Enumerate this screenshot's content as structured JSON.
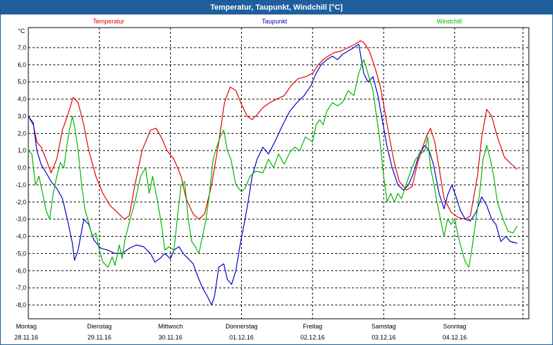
{
  "window": {
    "title": "Temperatur, Taupunkt, Windchill [°C]"
  },
  "colors": {
    "temperatur": "#e00000",
    "taupunkt": "#0000c8",
    "windchill": "#00b400",
    "grid": "#000000"
  },
  "chart_data": {
    "type": "line",
    "ylabel": "°C",
    "ylim": [
      -8.8,
      8.0
    ],
    "yticks": [
      "7,0",
      "6,0",
      "5,0",
      "4,0",
      "3,0",
      "2,0",
      "1,0",
      "0,0",
      "-1,0",
      "-2,0",
      "-3,0",
      "-4,0",
      "-5,0",
      "-6,0",
      "-7,0",
      "-8,0"
    ],
    "xlim": [
      0,
      7
    ],
    "grid": true,
    "days": [
      {
        "day": "Montag",
        "date": "28.11.16"
      },
      {
        "day": "Dienstag",
        "date": "29.11.16"
      },
      {
        "day": "Mittwoch",
        "date": "30.11.16"
      },
      {
        "day": "Donnerstag",
        "date": "01.12.16"
      },
      {
        "day": "Freitag",
        "date": "02.12.16"
      },
      {
        "day": "Samstag",
        "date": "03.12.16"
      },
      {
        "day": "Sonntag",
        "date": "04.12.16"
      }
    ],
    "series": [
      {
        "name": "Temperatur",
        "color": "#e00000",
        "points": [
          [
            0.0,
            3.0
          ],
          [
            0.07,
            2.5
          ],
          [
            0.12,
            1.5
          ],
          [
            0.18,
            1.2
          ],
          [
            0.25,
            0.5
          ],
          [
            0.32,
            -0.3
          ],
          [
            0.4,
            0.5
          ],
          [
            0.48,
            2.2
          ],
          [
            0.55,
            3.0
          ],
          [
            0.63,
            4.1
          ],
          [
            0.7,
            3.8
          ],
          [
            0.78,
            2.5
          ],
          [
            0.85,
            1.0
          ],
          [
            0.95,
            -0.5
          ],
          [
            1.05,
            -1.5
          ],
          [
            1.15,
            -2.2
          ],
          [
            1.25,
            -2.6
          ],
          [
            1.35,
            -3.0
          ],
          [
            1.42,
            -2.8
          ],
          [
            1.5,
            -1.0
          ],
          [
            1.6,
            1.0
          ],
          [
            1.72,
            2.2
          ],
          [
            1.8,
            2.3
          ],
          [
            1.88,
            1.7
          ],
          [
            1.95,
            1.0
          ],
          [
            2.05,
            0.5
          ],
          [
            2.15,
            -0.5
          ],
          [
            2.22,
            -1.8
          ],
          [
            2.32,
            -2.7
          ],
          [
            2.4,
            -3.0
          ],
          [
            2.48,
            -2.7
          ],
          [
            2.58,
            -1.0
          ],
          [
            2.68,
            1.5
          ],
          [
            2.76,
            3.8
          ],
          [
            2.84,
            4.7
          ],
          [
            2.92,
            4.5
          ],
          [
            3.0,
            3.7
          ],
          [
            3.08,
            3.0
          ],
          [
            3.15,
            2.8
          ],
          [
            3.22,
            3.1
          ],
          [
            3.3,
            3.5
          ],
          [
            3.4,
            3.8
          ],
          [
            3.5,
            4.0
          ],
          [
            3.6,
            4.2
          ],
          [
            3.7,
            4.8
          ],
          [
            3.8,
            5.2
          ],
          [
            3.9,
            5.3
          ],
          [
            4.0,
            5.5
          ],
          [
            4.08,
            6.0
          ],
          [
            4.15,
            6.3
          ],
          [
            4.22,
            6.5
          ],
          [
            4.3,
            6.7
          ],
          [
            4.4,
            6.8
          ],
          [
            4.5,
            7.0
          ],
          [
            4.6,
            7.2
          ],
          [
            4.67,
            7.4
          ],
          [
            4.72,
            7.3
          ],
          [
            4.8,
            6.8
          ],
          [
            4.88,
            5.8
          ],
          [
            4.95,
            4.8
          ],
          [
            5.02,
            3.2
          ],
          [
            5.08,
            1.8
          ],
          [
            5.15,
            0.3
          ],
          [
            5.22,
            -0.8
          ],
          [
            5.32,
            -1.3
          ],
          [
            5.4,
            -1.1
          ],
          [
            5.48,
            0.3
          ],
          [
            5.55,
            1.2
          ],
          [
            5.6,
            1.8
          ],
          [
            5.66,
            2.3
          ],
          [
            5.72,
            1.5
          ],
          [
            5.78,
            0.0
          ],
          [
            5.85,
            -1.8
          ],
          [
            5.95,
            -2.6
          ],
          [
            6.05,
            -2.9
          ],
          [
            6.15,
            -3.0
          ],
          [
            6.22,
            -2.8
          ],
          [
            6.32,
            -0.5
          ],
          [
            6.38,
            1.8
          ],
          [
            6.45,
            3.4
          ],
          [
            6.52,
            3.0
          ],
          [
            6.6,
            1.8
          ],
          [
            6.7,
            0.6
          ],
          [
            6.8,
            0.2
          ],
          [
            6.88,
            -0.1
          ]
        ]
      },
      {
        "name": "Taupunkt",
        "color": "#0000c8",
        "points": [
          [
            0.0,
            3.0
          ],
          [
            0.07,
            2.6
          ],
          [
            0.12,
            1.0
          ],
          [
            0.18,
            0.2
          ],
          [
            0.25,
            -0.3
          ],
          [
            0.32,
            -0.8
          ],
          [
            0.4,
            -1.2
          ],
          [
            0.48,
            -1.8
          ],
          [
            0.55,
            -3.0
          ],
          [
            0.62,
            -4.4
          ],
          [
            0.65,
            -5.4
          ],
          [
            0.7,
            -4.8
          ],
          [
            0.78,
            -3.0
          ],
          [
            0.85,
            -3.3
          ],
          [
            0.92,
            -4.2
          ],
          [
            1.02,
            -4.7
          ],
          [
            1.12,
            -4.8
          ],
          [
            1.22,
            -5.0
          ],
          [
            1.32,
            -5.0
          ],
          [
            1.42,
            -4.7
          ],
          [
            1.52,
            -4.5
          ],
          [
            1.62,
            -4.6
          ],
          [
            1.72,
            -5.0
          ],
          [
            1.78,
            -5.5
          ],
          [
            1.85,
            -5.3
          ],
          [
            1.92,
            -5.0
          ],
          [
            2.0,
            -5.3
          ],
          [
            2.05,
            -4.8
          ],
          [
            2.12,
            -4.6
          ],
          [
            2.18,
            -5.0
          ],
          [
            2.25,
            -5.3
          ],
          [
            2.32,
            -5.6
          ],
          [
            2.38,
            -6.3
          ],
          [
            2.45,
            -7.0
          ],
          [
            2.52,
            -7.5
          ],
          [
            2.58,
            -8.0
          ],
          [
            2.62,
            -7.5
          ],
          [
            2.68,
            -5.8
          ],
          [
            2.75,
            -5.6
          ],
          [
            2.8,
            -6.5
          ],
          [
            2.86,
            -6.8
          ],
          [
            2.92,
            -6.0
          ],
          [
            2.98,
            -4.5
          ],
          [
            3.05,
            -3.0
          ],
          [
            3.1,
            -1.8
          ],
          [
            3.15,
            -0.5
          ],
          [
            3.22,
            0.5
          ],
          [
            3.3,
            1.2
          ],
          [
            3.38,
            0.8
          ],
          [
            3.48,
            1.6
          ],
          [
            3.58,
            2.5
          ],
          [
            3.68,
            3.3
          ],
          [
            3.78,
            3.8
          ],
          [
            3.88,
            4.2
          ],
          [
            3.98,
            4.8
          ],
          [
            4.05,
            5.5
          ],
          [
            4.12,
            6.0
          ],
          [
            4.2,
            6.3
          ],
          [
            4.28,
            6.5
          ],
          [
            4.35,
            6.3
          ],
          [
            4.42,
            6.6
          ],
          [
            4.5,
            6.8
          ],
          [
            4.58,
            7.0
          ],
          [
            4.65,
            7.2
          ],
          [
            4.72,
            5.5
          ],
          [
            4.78,
            5.0
          ],
          [
            4.85,
            5.3
          ],
          [
            4.92,
            4.2
          ],
          [
            4.98,
            2.8
          ],
          [
            5.05,
            1.2
          ],
          [
            5.12,
            0.0
          ],
          [
            5.2,
            -1.0
          ],
          [
            5.28,
            -1.3
          ],
          [
            5.35,
            -1.0
          ],
          [
            5.42,
            -0.3
          ],
          [
            5.5,
            0.8
          ],
          [
            5.58,
            1.3
          ],
          [
            5.64,
            1.0
          ],
          [
            5.7,
            0.2
          ],
          [
            5.78,
            -1.5
          ],
          [
            5.85,
            -2.4
          ],
          [
            5.9,
            -1.6
          ],
          [
            5.96,
            -1.0
          ],
          [
            6.02,
            -1.7
          ],
          [
            6.08,
            -2.5
          ],
          [
            6.15,
            -3.0
          ],
          [
            6.22,
            -3.1
          ],
          [
            6.3,
            -2.6
          ],
          [
            6.38,
            -1.7
          ],
          [
            6.45,
            -2.2
          ],
          [
            6.52,
            -3.0
          ],
          [
            6.58,
            -3.3
          ],
          [
            6.65,
            -4.3
          ],
          [
            6.72,
            -4.0
          ],
          [
            6.78,
            -4.3
          ],
          [
            6.88,
            -4.4
          ]
        ]
      },
      {
        "name": "Windchill",
        "color": "#00b400",
        "points": [
          [
            0.0,
            1.0
          ],
          [
            0.05,
            0.8
          ],
          [
            0.1,
            -1.0
          ],
          [
            0.15,
            -0.5
          ],
          [
            0.2,
            -1.5
          ],
          [
            0.25,
            -2.5
          ],
          [
            0.3,
            -3.0
          ],
          [
            0.35,
            -1.5
          ],
          [
            0.4,
            -0.5
          ],
          [
            0.45,
            0.3
          ],
          [
            0.5,
            0.0
          ],
          [
            0.55,
            1.5
          ],
          [
            0.58,
            2.2
          ],
          [
            0.62,
            3.0
          ],
          [
            0.66,
            2.2
          ],
          [
            0.7,
            1.0
          ],
          [
            0.75,
            -1.0
          ],
          [
            0.8,
            -2.5
          ],
          [
            0.85,
            -3.2
          ],
          [
            0.9,
            -4.0
          ],
          [
            0.95,
            -3.8
          ],
          [
            1.0,
            -4.8
          ],
          [
            1.05,
            -5.5
          ],
          [
            1.12,
            -5.8
          ],
          [
            1.18,
            -5.2
          ],
          [
            1.22,
            -5.7
          ],
          [
            1.28,
            -4.5
          ],
          [
            1.32,
            -5.3
          ],
          [
            1.36,
            -4.2
          ],
          [
            1.42,
            -3.2
          ],
          [
            1.5,
            -2.0
          ],
          [
            1.58,
            -0.5
          ],
          [
            1.65,
            0.0
          ],
          [
            1.7,
            -1.5
          ],
          [
            1.75,
            -0.5
          ],
          [
            1.82,
            -2.0
          ],
          [
            1.88,
            -3.5
          ],
          [
            1.92,
            -4.8
          ],
          [
            1.98,
            -4.6
          ],
          [
            2.05,
            -4.8
          ],
          [
            2.1,
            -2.8
          ],
          [
            2.15,
            -1.0
          ],
          [
            2.2,
            -0.8
          ],
          [
            2.25,
            -3.0
          ],
          [
            2.3,
            -4.3
          ],
          [
            2.35,
            -4.6
          ],
          [
            2.4,
            -5.0
          ],
          [
            2.45,
            -4.0
          ],
          [
            2.5,
            -3.0
          ],
          [
            2.55,
            -1.5
          ],
          [
            2.6,
            0.5
          ],
          [
            2.65,
            1.2
          ],
          [
            2.7,
            1.8
          ],
          [
            2.75,
            2.2
          ],
          [
            2.8,
            1.0
          ],
          [
            2.85,
            0.5
          ],
          [
            2.92,
            -1.0
          ],
          [
            3.0,
            -1.4
          ],
          [
            3.05,
            -1.2
          ],
          [
            3.12,
            -0.5
          ],
          [
            3.2,
            -0.2
          ],
          [
            3.3,
            -0.3
          ],
          [
            3.38,
            0.5
          ],
          [
            3.45,
            0.0
          ],
          [
            3.52,
            0.8
          ],
          [
            3.6,
            0.2
          ],
          [
            3.68,
            0.9
          ],
          [
            3.75,
            1.2
          ],
          [
            3.82,
            1.0
          ],
          [
            3.9,
            1.8
          ],
          [
            4.0,
            1.5
          ],
          [
            4.05,
            2.5
          ],
          [
            4.1,
            2.8
          ],
          [
            4.15,
            2.5
          ],
          [
            4.2,
            3.3
          ],
          [
            4.28,
            3.8
          ],
          [
            4.35,
            3.6
          ],
          [
            4.42,
            3.8
          ],
          [
            4.5,
            4.5
          ],
          [
            4.58,
            4.2
          ],
          [
            4.65,
            5.5
          ],
          [
            4.72,
            6.3
          ],
          [
            4.8,
            5.2
          ],
          [
            4.85,
            4.5
          ],
          [
            4.9,
            3.0
          ],
          [
            4.95,
            1.5
          ],
          [
            5.0,
            -0.5
          ],
          [
            5.05,
            -2.0
          ],
          [
            5.1,
            -1.5
          ],
          [
            5.15,
            -2.0
          ],
          [
            5.2,
            -1.5
          ],
          [
            5.25,
            -1.8
          ],
          [
            5.3,
            -1.2
          ],
          [
            5.38,
            -0.2
          ],
          [
            5.45,
            0.5
          ],
          [
            5.52,
            0.8
          ],
          [
            5.58,
            1.0
          ],
          [
            5.62,
            1.8
          ],
          [
            5.66,
            0.0
          ],
          [
            5.7,
            -0.8
          ],
          [
            5.75,
            -2.0
          ],
          [
            5.8,
            -3.0
          ],
          [
            5.85,
            -4.0
          ],
          [
            5.9,
            -3.0
          ],
          [
            5.95,
            -3.3
          ],
          [
            6.0,
            -3.0
          ],
          [
            6.05,
            -4.0
          ],
          [
            6.1,
            -4.8
          ],
          [
            6.15,
            -5.5
          ],
          [
            6.2,
            -5.8
          ],
          [
            6.25,
            -4.5
          ],
          [
            6.3,
            -3.0
          ],
          [
            6.35,
            -1.5
          ],
          [
            6.4,
            0.5
          ],
          [
            6.45,
            1.3
          ],
          [
            6.5,
            0.5
          ],
          [
            6.55,
            -0.5
          ],
          [
            6.6,
            -2.0
          ],
          [
            6.68,
            -3.0
          ],
          [
            6.75,
            -3.7
          ],
          [
            6.82,
            -3.8
          ],
          [
            6.88,
            -3.4
          ]
        ]
      }
    ]
  }
}
